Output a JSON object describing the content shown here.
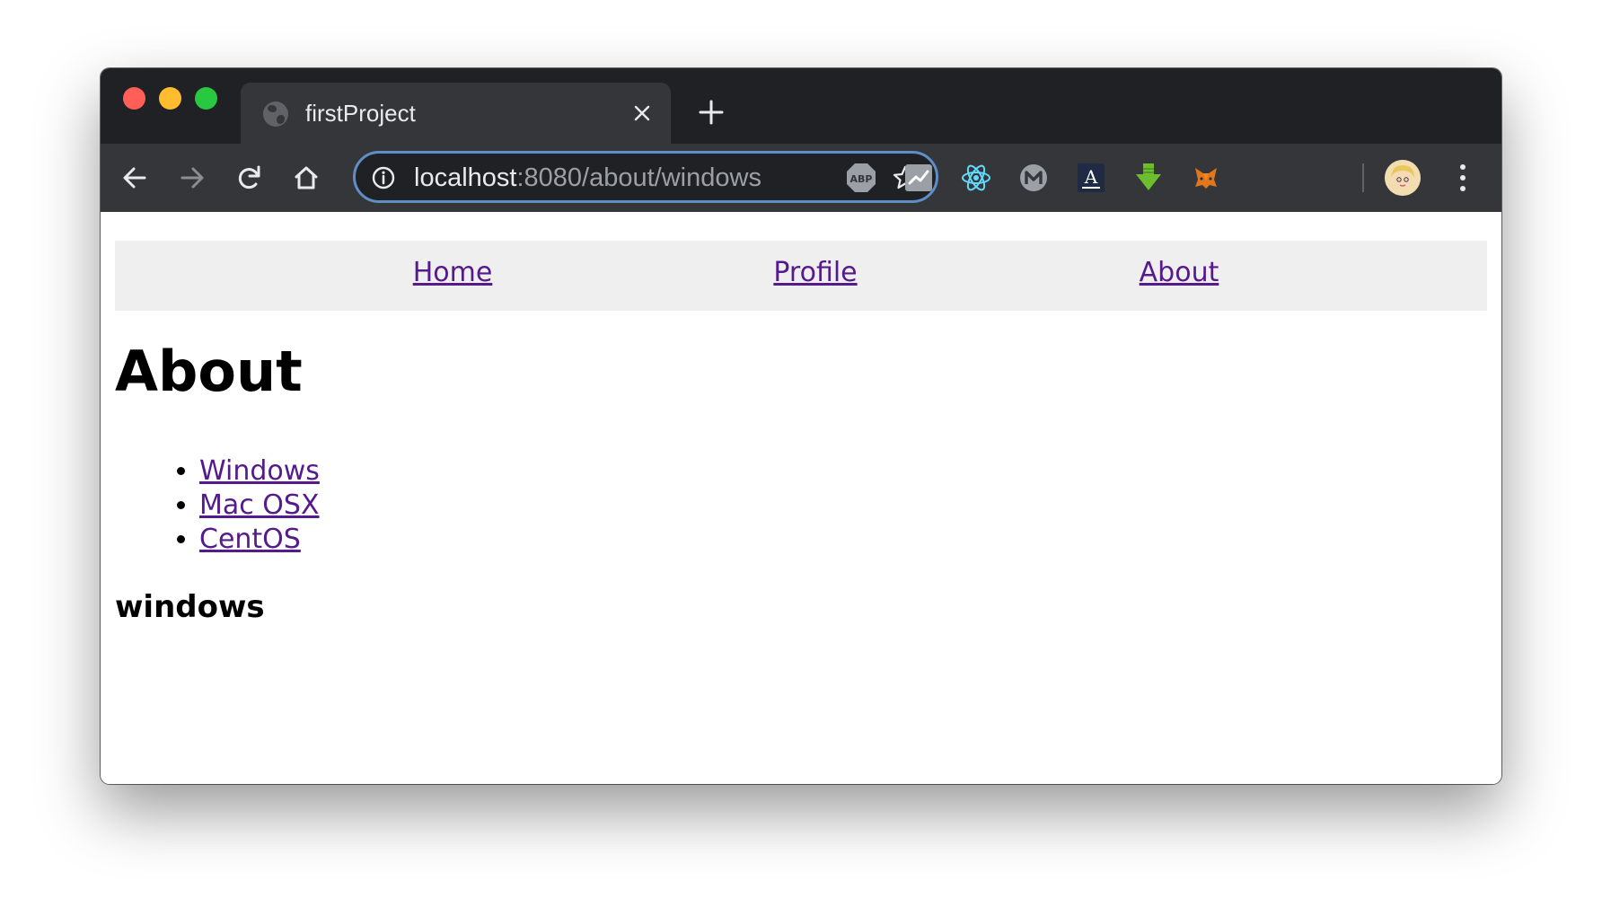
{
  "browser": {
    "tab_title": "firstProject",
    "url_host": "localhost",
    "url_path": ":8080/about/windows",
    "extensions": [
      "adblock-plus-icon",
      "stats-chart-icon",
      "react-devtools-icon",
      "mercury-m-icon",
      "font-a-icon",
      "green-download-arrow-icon",
      "metamask-fox-icon"
    ],
    "abp_label": "ABP",
    "font_ext_label": "A"
  },
  "nav": {
    "links": [
      {
        "label": "Home"
      },
      {
        "label": "Profile"
      },
      {
        "label": "About"
      }
    ]
  },
  "page": {
    "title": "About",
    "os_links": [
      {
        "label": "Windows"
      },
      {
        "label": "Mac OSX"
      },
      {
        "label": "CentOS"
      }
    ],
    "selected": "windows"
  },
  "colors": {
    "tabbar_bg": "#202124",
    "toolbar_bg": "#35363a",
    "omnibox_border": "#5f8ec7",
    "visited_link": "#551a8b",
    "nav_bg": "#efefef"
  }
}
